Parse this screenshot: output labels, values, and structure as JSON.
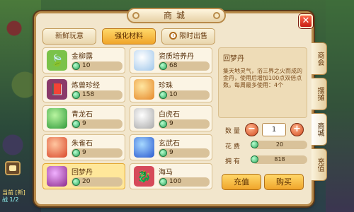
{
  "background": {
    "top_text": "",
    "bottom_line1": "当前 [新]",
    "bottom_line2": "战 1/2"
  },
  "title": "商城",
  "close_symbol": "✕",
  "tabs": [
    {
      "label": "新鲜玩意",
      "active": false
    },
    {
      "label": "强化材料",
      "active": true
    },
    {
      "label": "限时出售",
      "active": false
    }
  ],
  "items": [
    {
      "name": "金柳露",
      "price": "10",
      "icon": "green-dew-icon"
    },
    {
      "name": "资质培养丹",
      "price": "68",
      "icon": "crystal-orb-icon"
    },
    {
      "name": "炼兽珍经",
      "price": "158",
      "icon": "book-icon"
    },
    {
      "name": "珍珠",
      "price": "10",
      "icon": "pearl-icon"
    },
    {
      "name": "青龙石",
      "price": "9",
      "icon": "dragon-stone-icon"
    },
    {
      "name": "白虎石",
      "price": "9",
      "icon": "tiger-stone-icon"
    },
    {
      "name": "朱雀石",
      "price": "9",
      "icon": "phoenix-stone-icon"
    },
    {
      "name": "玄武石",
      "price": "9",
      "icon": "tortoise-stone-icon"
    },
    {
      "name": "回梦丹",
      "price": "20",
      "icon": "dream-pill-icon",
      "selected": true
    },
    {
      "name": "海马",
      "price": "100",
      "icon": "seahorse-icon"
    }
  ],
  "detail": {
    "name": "回梦丹",
    "description": "集天地灵气，浴三界之火而成的金丹，使用后增加100点双倍点数。每周最多使用：4个"
  },
  "quantity": {
    "label": "数 量",
    "value": "1",
    "minus": "−",
    "plus": "+"
  },
  "cost": {
    "label": "花 费",
    "value": "20"
  },
  "owned": {
    "label": "拥 有",
    "value": "818"
  },
  "buttons": {
    "recharge": "充值",
    "buy": "购买"
  },
  "side_tabs": [
    {
      "label": "商会",
      "active": false
    },
    {
      "label": "摆摊",
      "active": false
    },
    {
      "label": "商城",
      "active": true
    },
    {
      "label": "充值",
      "active": false
    }
  ],
  "colors": {
    "accent": "#f0a52a",
    "panel": "#f2e6cc",
    "border": "#b88a4a",
    "close": "#c81e14"
  }
}
